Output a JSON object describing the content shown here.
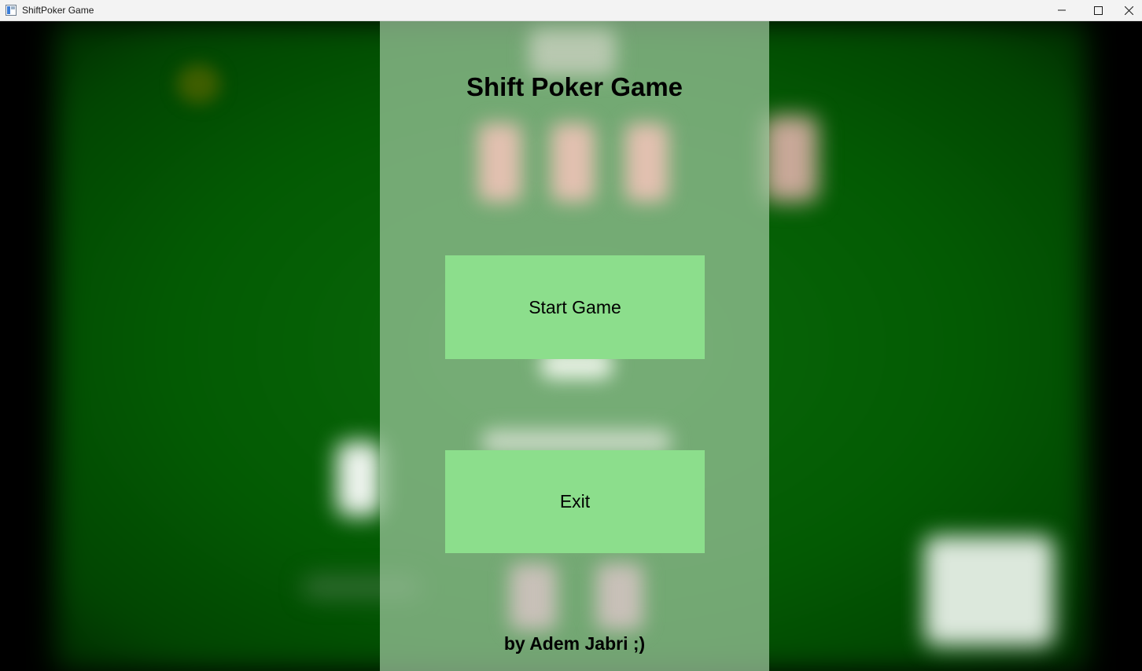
{
  "window": {
    "title": "ShiftPoker Game",
    "app_icon": "app-window-icon",
    "controls": [
      "minimize-icon",
      "maximize-icon",
      "close-icon"
    ]
  },
  "menu": {
    "title": "Shift Poker Game",
    "start_label": "Start Game",
    "exit_label": "Exit",
    "credit": "by Adem Jabri ;)"
  },
  "colors": {
    "table_felt": "#035a03",
    "panel_overlay": "#a0c8a0",
    "button_bg": "#8cde8c",
    "text": "#000000"
  }
}
